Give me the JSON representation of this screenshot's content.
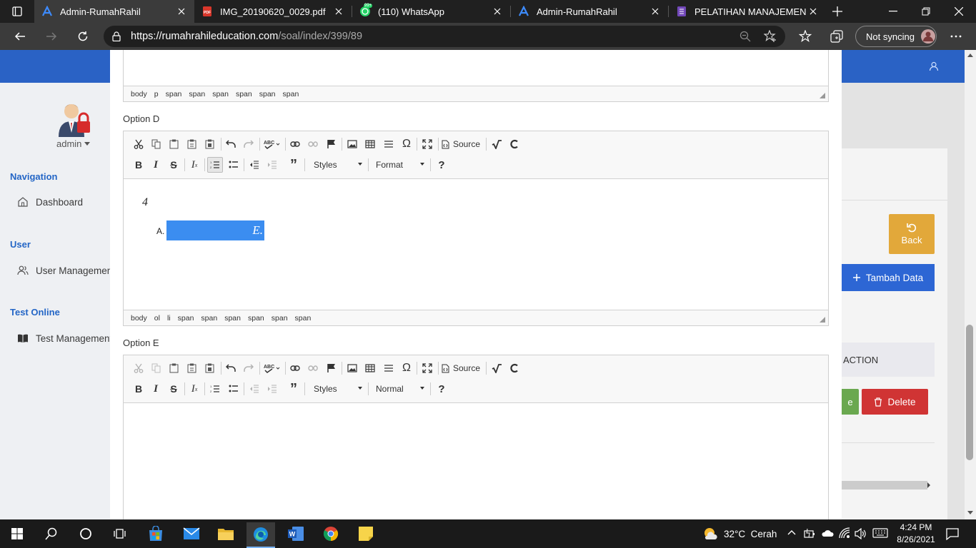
{
  "tabs": [
    {
      "title": "Admin-RumahRahil",
      "icon": "rumahrahil-a-icon",
      "active": true
    },
    {
      "title": "IMG_20190620_0029.pdf",
      "icon": "pdf-icon"
    },
    {
      "title": "(110) WhatsApp",
      "icon": "whatsapp-icon",
      "badge": "99+"
    },
    {
      "title": "Admin-RumahRahil",
      "icon": "rumahrahil-a-icon"
    },
    {
      "title": "PELATIHAN MANAJEMEN OR",
      "icon": "forms-icon"
    }
  ],
  "browser": {
    "url_host": "https://rumahrahileducation.com",
    "url_path": "/soal/index/399/89",
    "sync_label": "Not syncing"
  },
  "sidebar": {
    "user": "admin",
    "sections": [
      {
        "header": "Navigation",
        "item": "Dashboard"
      },
      {
        "header": "User",
        "item": "User Managemen"
      },
      {
        "header": "Test Online",
        "item": "Test Management"
      }
    ]
  },
  "right_panel": {
    "back_label": "Back",
    "add_label": "Tambah Data",
    "action_header": "ACTION",
    "delete_label": "Delete",
    "edit_partial": "e"
  },
  "editors": {
    "top_path": [
      "body",
      "p",
      "span",
      "span",
      "span",
      "span",
      "span",
      "span"
    ],
    "option_d": {
      "label": "Option D",
      "styles": "Styles",
      "format": "Format",
      "source": "Source",
      "help": "?",
      "content_number": "4",
      "list_marker": "A.",
      "list_text": "E.",
      "path": [
        "body",
        "ol",
        "li",
        "span",
        "span",
        "span",
        "span",
        "span",
        "span"
      ]
    },
    "option_e": {
      "label": "Option E",
      "styles": "Styles",
      "format": "Normal",
      "source": "Source",
      "help": "?"
    }
  },
  "taskbar": {
    "weather": "32°C  Cerah",
    "time": "4:24 PM",
    "date": "8/26/2021"
  },
  "colors": {
    "accent_blue": "#2a62c5",
    "back_button": "#e2a83a",
    "add_button": "#2d66d4",
    "delete_button": "#d03434",
    "edit_button": "#6aa84f",
    "selection": "#3b8df0"
  }
}
